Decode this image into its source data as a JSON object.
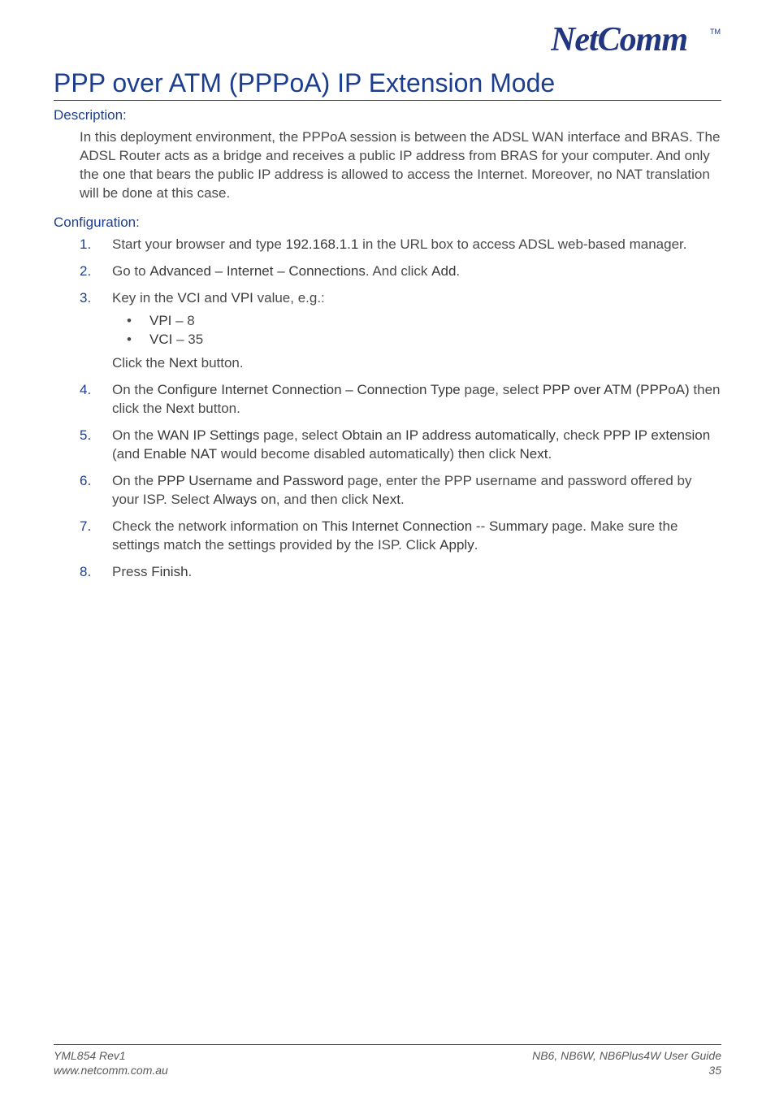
{
  "brand": {
    "name": "NetComm",
    "tm": "TM"
  },
  "title": "PPP over ATM (PPPoA) IP Extension Mode",
  "sections": {
    "description": {
      "heading": "Description:",
      "text": "In this deployment environment, the PPPoA session is between the ADSL WAN interface and BRAS. The ADSL Router acts as a bridge and receives a public IP address from BRAS for your computer. And only the one that bears the public IP address is allowed to access the Internet. Moreover, no NAT translation will be done at this case."
    },
    "configuration": {
      "heading": "Configuration:",
      "step1": {
        "pre": "Start your browser and type ",
        "b1": "192.168.1.1",
        "post": " in the URL box to access ADSL web-based manager."
      },
      "step2": {
        "pre": "Go to ",
        "b1": "Advanced – Internet – Connections",
        "mid": ". And click ",
        "b2": "Add",
        "post": "."
      },
      "step3": {
        "pre": "Key in the ",
        "b1": "VCI",
        "mid1": " and ",
        "b2": "VPI",
        "post1": " value, e.g.:",
        "bullets": {
          "a": {
            "b": "VPI",
            "t": " – 8"
          },
          "c": {
            "b": "VCI",
            "t": " – 35"
          }
        },
        "extra": {
          "pre": "Click the ",
          "b": "Next",
          "post": " button."
        }
      },
      "step4": {
        "pre": "On the ",
        "b1": "Configure Internet Connection – Connection Type",
        "mid1": " page, select ",
        "b2": "PPP over ATM (PPPoA)",
        "mid2": " then click the ",
        "b3": "Next",
        "post": " button."
      },
      "step5": {
        "pre": "On the ",
        "b1": "WAN IP Settings",
        "mid1": " page, select ",
        "b2": "Obtain an IP address automatically",
        "mid2": ", check ",
        "b3": "PPP IP extension",
        "mid3": " (and ",
        "b4": "Enable NAT",
        "mid4": " would become disabled automatically) then click ",
        "b5": "Next",
        "post": "."
      },
      "step6": {
        "pre": "On the ",
        "b1": "PPP Username and Password",
        "mid1": " page, enter the PPP username and password offered by your ISP. Select ",
        "b2": "Always on",
        "mid2": ", and then click ",
        "b3": "Next",
        "post": "."
      },
      "step7": {
        "pre": "Check the network information on ",
        "b1": "This Internet Connection",
        "mid1": " -- ",
        "b2": "Summary",
        "mid2": " page. Make sure the settings match the settings provided by the ISP. Click ",
        "b3": "Apply",
        "post": "."
      },
      "step8": {
        "pre": "Press ",
        "b1": "Finish",
        "post": "."
      }
    }
  },
  "footer": {
    "rev": "YML854 Rev1",
    "url": "www.netcomm.com.au",
    "models": "NB6, NB6W, NB6Plus4W",
    "guide": " User Guide",
    "page": "35"
  }
}
